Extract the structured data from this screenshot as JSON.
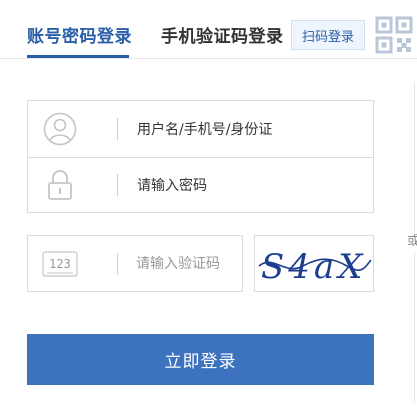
{
  "tabs": {
    "account_login": "账号密码登录",
    "sms_login": "手机验证码登录",
    "qr_login": "扫码登录"
  },
  "form": {
    "username_label": "用户名/手机号/身份证",
    "password_label": "请输入密码",
    "code_placeholder": "请输入验证码",
    "code_icon_text": "123"
  },
  "captcha": {
    "text": "S4aX"
  },
  "buttons": {
    "login_label": "立即登录"
  },
  "edge_text": "或",
  "colors": {
    "accent": "#2a5ea8",
    "button_bg": "#3d72bf",
    "border": "#dcdcdc",
    "captcha_ink": "#1d3d8f"
  }
}
